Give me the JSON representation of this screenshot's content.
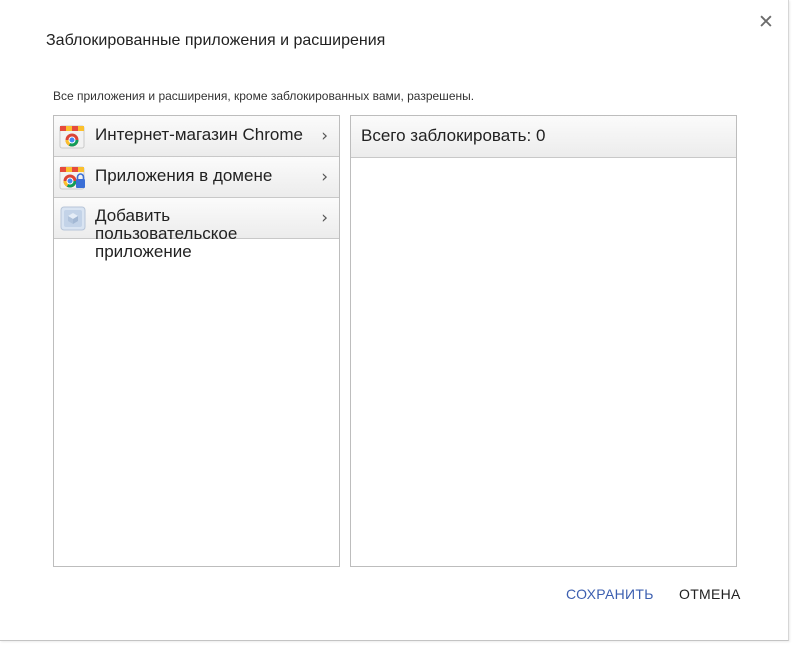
{
  "dialog": {
    "title": "Заблокированные приложения и расширения",
    "description": "Все приложения и расширения, кроме заблокированных вами, разрешены.",
    "close_icon": "close-icon"
  },
  "sources": {
    "items": [
      {
        "label": "Интернет-магазин Chrome",
        "icon": "chrome-web-store-icon"
      },
      {
        "label": "Приложения в домене",
        "icon": "domain-apps-icon"
      },
      {
        "label": "Добавить пользовательское приложение",
        "icon": "custom-app-icon"
      }
    ],
    "chevron": "›"
  },
  "blocked": {
    "header": "Всего заблокировать: 0"
  },
  "actions": {
    "save_label": "СОХРАНИТЬ",
    "cancel_label": "ОТМЕНА"
  },
  "colors": {
    "accent": "#3c5fb0"
  }
}
